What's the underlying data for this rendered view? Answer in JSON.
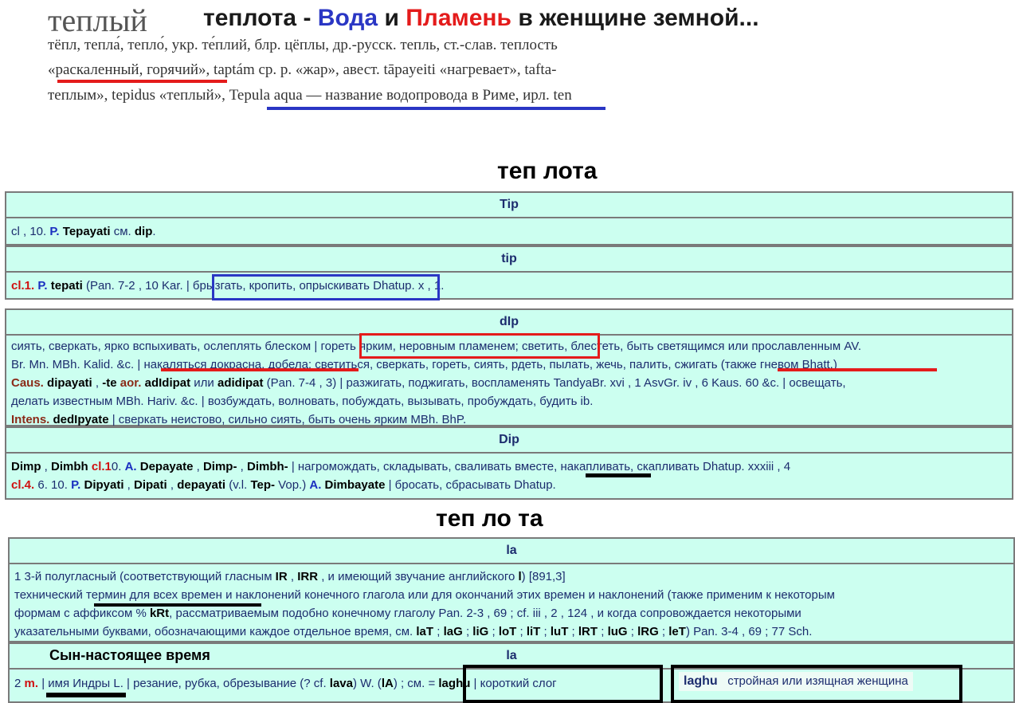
{
  "header": {
    "headword": "теплый",
    "title_a": "теплота - ",
    "title_water": "Вода",
    "title_b": " и ",
    "title_flame": "Пламень",
    "title_c": " в женщине земной..."
  },
  "etymology": {
    "line1": "тёпл, тепла́, тепло́, укр. те́плий, блр. цёплы, др.-русск. тепль, ст.-слав. теплость",
    "line2": "«раскаленный, горячий», taptám ср. р. «жар», авест. tāpayeiti «нагревает», tafta-",
    "line3": " теплым», tepidus «теплый», Tepula aqua — название водопровода в Риме, ирл. ten"
  },
  "section1": {
    "title": "теп  лота"
  },
  "section2": {
    "title": "теп  ло  та"
  },
  "entries": {
    "tip_cap": {
      "header": "Tip",
      "l1": {
        "a": "cl , 10. ",
        "b": "P.",
        "c": " ",
        "d": "Tepayati",
        "e": " см. ",
        "f": "dip",
        "g": "."
      }
    },
    "tip": {
      "header": "tip",
      "l1": {
        "a": "cl.1.",
        "b": " P.",
        "c": " ",
        "d": "tepati",
        "e": " (Pan. 7-2 , 10 Kar. | брызгать, кропить, опрыскивать Dhatup. x , 1."
      }
    },
    "dip": {
      "header": "dIp",
      "l1": "сиять, сверкать, ярко вспыхивать, ослеплять блеском | гореть ярким, неровным пламенем; светить, блестеть, быть светящимся или прославленным AV.",
      "l2": "Br. Mn. MBh. Kalid. &c. | накаляться докрасна, добела; светиться, сверкать, гореть, сиять, рдеть, пылать, жечь, палить, сжигать (также гневом Bhatt.)",
      "l3": {
        "a": "Caus.",
        "b": " ",
        "c": "dipayati",
        "d": " , ",
        "e": "-te",
        "f": " ",
        "g": "aor.",
        "h": " ",
        "i": "adIdipat",
        "j": " или ",
        "k": "adidipat",
        "l": " (Pan. 7-4 , 3) | разжигать, поджигать, воспламенять TandyaBr. xvi , 1 AsvGr. iv , 6 Kaus. 60 &c. | освещать,"
      },
      "l4": "делать известным MBh. Hariv. &c. | возбуждать, волновать, побуждать, вызывать, пробуждать, будить ib.",
      "l5": {
        "a": "Intens.",
        "b": " ",
        "c": "dedIpyate",
        "d": " | сверкать неистово, сильно сиять, быть очень ярким MBh. BhP."
      }
    },
    "dip_cap": {
      "header": "Dip",
      "l1": {
        "a": "Dimp",
        "b": " , ",
        "c": "Dimbh",
        "d": " ",
        "e": "cl.1",
        "f": "0. ",
        "g": "A.",
        "h": " ",
        "i": "Depayate",
        "j": " , ",
        "k": "Dimp-",
        "l": " , ",
        "m": "Dimbh-",
        "n": " | нагромождать, складывать, сваливать вместе, накапливать, скапливать Dhatup. xxxiii , 4"
      },
      "l2": {
        "a": "cl.4.",
        "b": " 6. 10. ",
        "c": "P.",
        "d": " ",
        "e": "Dipyati",
        "f": " , ",
        "g": "Dipati",
        "h": " , ",
        "i": "depayati",
        "j": " (v.l. ",
        "k": "Tep-",
        "l": " Vop.) ",
        "m": "A.",
        "n": " ",
        "o": "Dimbayate",
        "p": " | бросать, сбрасывать Dhatup."
      }
    },
    "la1": {
      "header": "la",
      "l1": {
        "a": "1 3-й полугласный (соответствующий гласным ",
        "b": "IR",
        "c": " , ",
        "d": "IRR",
        "e": " , и имеющий звучание английского ",
        "f": "l",
        "g": ") [891,3]"
      },
      "l2": "технический термин для всех времен и наклонений конечного глагола или для окончаний этих времен и наклонений (также применим к некоторым",
      "l3": {
        "a": "формам с аффиксом % ",
        "b": "kRt",
        "c": ", рассматриваемым подобно конечному глаголу Pan. 2-3 , 69 ; cf. iii , 2 , 124 , и когда сопровождается некоторыми"
      },
      "l4": {
        "a": "указательными буквами, обозначающими каждое отдельное время, см. ",
        "b": "laT",
        "c": " ; ",
        "d": "laG",
        "e": " ; ",
        "f": "liG",
        "g": " ; ",
        "h": "loT",
        "i": " ; ",
        "j": "liT",
        "k": " ; ",
        "l": "luT",
        "m": " ; ",
        "n": "lRT",
        "o": " ; ",
        "p": "luG",
        "q": " ; ",
        "r": "lRG",
        "s": " ; ",
        "t": "leT",
        "u": ") Pan. 3-4 , 69 ; 77 Sch."
      }
    },
    "la2": {
      "header": "la",
      "caption": "Сын-настоящее время",
      "l1": {
        "a": "2 ",
        "b": "m.",
        "c": " | имя Индры L. | резание, рубка, обрезывание (? cf. ",
        "d": "lava",
        "e": ") W. (",
        "f": "lA",
        "g": ") ; см.  = ",
        "h": "laghu",
        "i": " | короткий слог"
      },
      "side": {
        "a": "laghu",
        "b": "стройная или изящная женщина"
      }
    }
  },
  "colors": {
    "water": "#2a36c4",
    "flame": "#e41b1b",
    "cell_bg": "#ccfff0",
    "border": "#7a7a7a",
    "text_navy": "#1c2c6e"
  }
}
